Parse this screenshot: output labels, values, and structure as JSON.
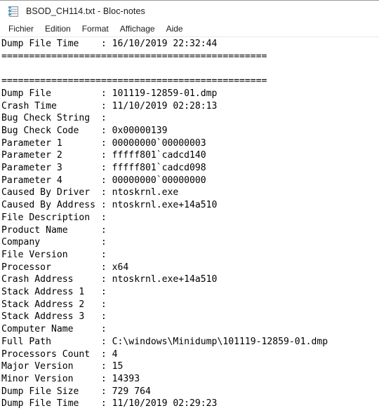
{
  "window": {
    "title": "BSOD_CH114.txt - Bloc-notes",
    "icon": "notepad-icon"
  },
  "menubar": {
    "items": [
      {
        "label": "Fichier"
      },
      {
        "label": "Edition"
      },
      {
        "label": "Format"
      },
      {
        "label": "Affichage"
      },
      {
        "label": "Aide"
      }
    ]
  },
  "document": {
    "separator": "================================================",
    "label_width": 18,
    "lines": [
      {
        "label": "Dump File Time",
        "value": "16/10/2019 22:32:44"
      },
      {
        "raw": "================================================"
      },
      {
        "raw": ""
      },
      {
        "raw": "================================================"
      },
      {
        "label": "Dump File",
        "value": "101119-12859-01.dmp"
      },
      {
        "label": "Crash Time",
        "value": "11/10/2019 02:28:13"
      },
      {
        "label": "Bug Check String",
        "value": ""
      },
      {
        "label": "Bug Check Code",
        "value": "0x00000139"
      },
      {
        "label": "Parameter 1",
        "value": "00000000`00000003"
      },
      {
        "label": "Parameter 2",
        "value": "fffff801`cadcd140"
      },
      {
        "label": "Parameter 3",
        "value": "fffff801`cadcd098"
      },
      {
        "label": "Parameter 4",
        "value": "00000000`00000000"
      },
      {
        "label": "Caused By Driver",
        "value": "ntoskrnl.exe"
      },
      {
        "label": "Caused By Address",
        "value": "ntoskrnl.exe+14a510"
      },
      {
        "label": "File Description",
        "value": ""
      },
      {
        "label": "Product Name",
        "value": ""
      },
      {
        "label": "Company",
        "value": ""
      },
      {
        "label": "File Version",
        "value": ""
      },
      {
        "label": "Processor",
        "value": "x64"
      },
      {
        "label": "Crash Address",
        "value": "ntoskrnl.exe+14a510"
      },
      {
        "label": "Stack Address 1",
        "value": ""
      },
      {
        "label": "Stack Address 2",
        "value": ""
      },
      {
        "label": "Stack Address 3",
        "value": ""
      },
      {
        "label": "Computer Name",
        "value": ""
      },
      {
        "label": "Full Path",
        "value": "C:\\windows\\Minidump\\101119-12859-01.dmp"
      },
      {
        "label": "Processors Count",
        "value": "4"
      },
      {
        "label": "Major Version",
        "value": "15"
      },
      {
        "label": "Minor Version",
        "value": "14393"
      },
      {
        "label": "Dump File Size",
        "value": "729 764"
      },
      {
        "label": "Dump File Time",
        "value": "11/10/2019 02:29:23"
      }
    ]
  },
  "colors": {
    "window_bg": "#ffffff",
    "text": "#000000",
    "title_text": "#1b1b1b",
    "menu_separator": "#e9e9e9",
    "top_border": "#9a9a9a"
  }
}
